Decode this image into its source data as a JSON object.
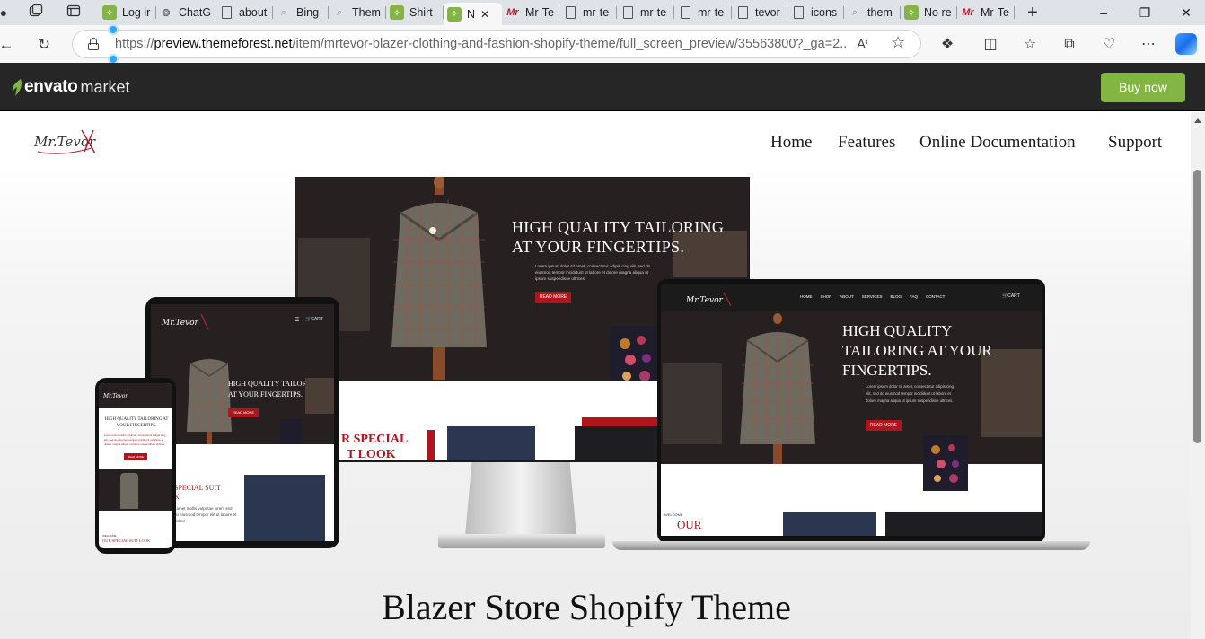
{
  "browser": {
    "tabs": [
      {
        "label": "Log ir",
        "favicon": "green-leaf-icon"
      },
      {
        "label": "ChatG",
        "favicon": "openai-icon"
      },
      {
        "label": "about",
        "favicon": "page-icon"
      },
      {
        "label": "Bing",
        "favicon": "search-icon"
      },
      {
        "label": "Them",
        "favicon": "search-icon"
      },
      {
        "label": "Shirt",
        "favicon": "envato-icon"
      },
      {
        "label": "N",
        "favicon": "envato-icon",
        "active": true
      },
      {
        "label": "Mr-Te",
        "favicon": "mrtevor-icon"
      },
      {
        "label": "mr-te",
        "favicon": "page-icon"
      },
      {
        "label": "mr-te",
        "favicon": "page-icon"
      },
      {
        "label": "mr-te",
        "favicon": "page-icon"
      },
      {
        "label": "tevor",
        "favicon": "page-icon"
      },
      {
        "label": "icons",
        "favicon": "page-icon"
      },
      {
        "label": "them",
        "favicon": "search-icon"
      },
      {
        "label": "No re",
        "favicon": "envato-icon"
      },
      {
        "label": "Mr-Te",
        "favicon": "mrtevor-icon"
      }
    ],
    "new_tab_symbol": "+",
    "url_prefix": "https://",
    "url_domain": "preview.themeforest.net",
    "url_path": "/item/mrtevor-blazer-clothing-and-fashion-shopify-theme/full_screen_preview/35563800?_ga=2...."
  },
  "envato": {
    "logo_bold": "envato",
    "logo_light": "market",
    "buy_label": "Buy now",
    "accent": "#82b541"
  },
  "site": {
    "logo_text": "Mr.Tevor",
    "nav": [
      "Home",
      "Features",
      "Online Documentation",
      "Support"
    ],
    "hero_title": "Blazer Store Shopify Theme"
  },
  "mockups": {
    "desktop_heading_line1": "HIGH QUALITY TAILORING",
    "desktop_heading_line2": "AT YOUR FINGERTIPS.",
    "desktop_body": "Lorem ipsum dolor sit amet, consectetur adipis cing elit, sed do eiusmod tempor incididunt ut labore et dolore magna aliqua ut ipsum suspendisse ultrices.",
    "read_more": "READ MORE",
    "desktop_section": "R SPECIAL",
    "desktop_section2": "T LOOK",
    "laptop_nav": [
      "HOME",
      "SHOP",
      "ABOUT",
      "SERVICES",
      "BLOG",
      "FAQ",
      "CONTACT"
    ],
    "laptop_cart": "CART",
    "laptop_heading_line1": "HIGH QUALITY",
    "laptop_heading_line2": "TAILORING AT YOUR",
    "laptop_heading_line3": "FINGERTIPS.",
    "laptop_welcome": "WELCOME",
    "laptop_section": "OUR",
    "tablet_heading_line1": "HIGH QUALITY TAILORING",
    "tablet_heading_line2": "AT YOUR FINGERTIPS.",
    "tablet_cart": "CART",
    "tablet_section": "SPECIAL SUIT",
    "tablet_section2": "K",
    "tablet_body": "t amet mollis vulputae lorem sed do eiusmod tempor elit ut labore et dolore",
    "phone_heading_line1": "HIGH QUALITY TAILORING AT",
    "phone_heading_line2": "YOUR FINGERTIPS.",
    "phone_welcome": "WELCOME",
    "phone_section": "OUR SPECIAL SUIT LOOK",
    "brand_red": "#b0151e"
  }
}
